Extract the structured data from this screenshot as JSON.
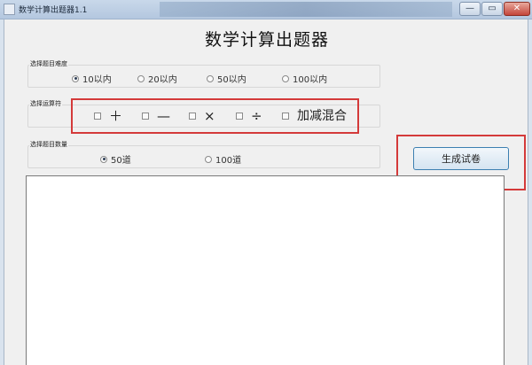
{
  "window": {
    "title": "数学计算出题器1.1",
    "controls": {
      "minimize": "—",
      "maximize": "▭",
      "close": "✕"
    }
  },
  "heading": "数学计算出题器",
  "difficulty": {
    "label": "选择题目难度",
    "options": [
      {
        "label": "10以内",
        "selected": true
      },
      {
        "label": "20以内",
        "selected": false
      },
      {
        "label": "50以内",
        "selected": false
      },
      {
        "label": "100以内",
        "selected": false
      }
    ]
  },
  "operators": {
    "label": "选择运算符",
    "options": [
      {
        "label": "＋",
        "checked": false
      },
      {
        "label": "—",
        "checked": false
      },
      {
        "label": "×",
        "checked": false
      },
      {
        "label": "÷",
        "checked": false
      },
      {
        "label": "加减混合",
        "checked": false
      }
    ]
  },
  "count": {
    "label": "选择题目数量",
    "options": [
      {
        "label": "50道",
        "selected": true
      },
      {
        "label": "100道",
        "selected": false
      }
    ]
  },
  "generate_button": "生成试卷",
  "colors": {
    "highlight_red": "#d43a3a",
    "button_border": "#3c7fb1"
  }
}
